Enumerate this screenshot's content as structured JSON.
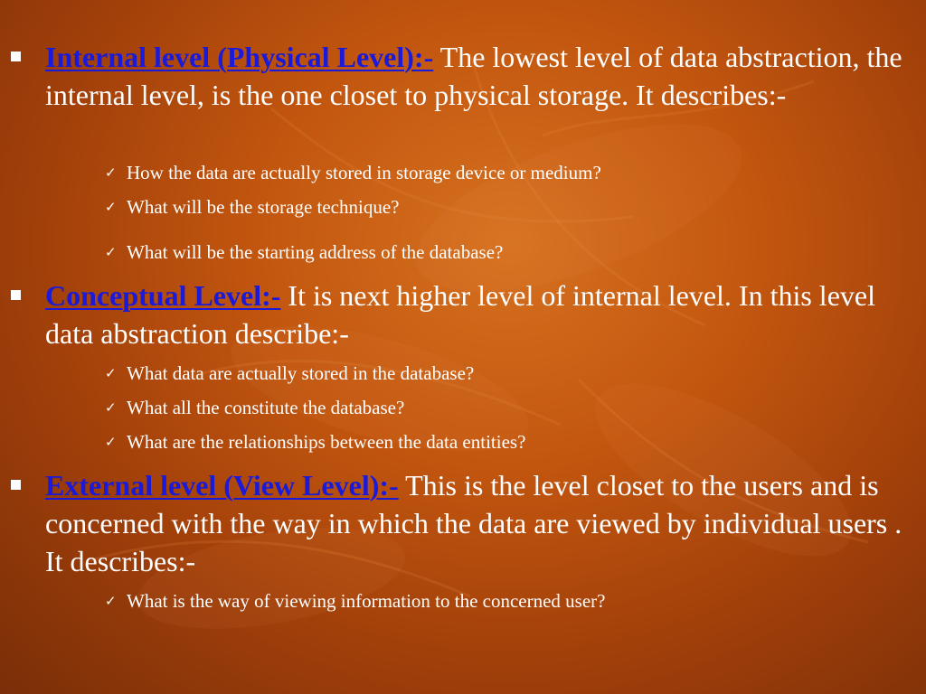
{
  "bullets": [
    {
      "heading": "Internal level (Physical Level):-",
      "text": " The lowest level of data abstraction, the internal level, is the one closet to physical storage. It describes:-",
      "items": [
        "How the data are actually stored in storage device or medium?",
        "What will be the storage technique?",
        "What will be the starting address of the database?"
      ]
    },
    {
      "heading": "Conceptual Level:-",
      "text": " It is next higher level of internal level. In this level data abstraction describe:-",
      "items": [
        "What data are actually stored in the database?",
        "What all the constitute the database?",
        "What are the relationships between the data entities?"
      ]
    },
    {
      "heading": "External level (View Level):-",
      "text": " This is the level closet to the users and is concerned with the way in which the data are viewed by individual users . It describes:-",
      "items": [
        "What is the way of viewing information to the concerned user?"
      ]
    }
  ],
  "icons": {
    "bullet": "square-bullet-icon",
    "sub_bullet": "checkmark-icon"
  },
  "colors": {
    "heading": "#1a1ad8",
    "text": "#ffffff",
    "background": "#c2560f"
  }
}
